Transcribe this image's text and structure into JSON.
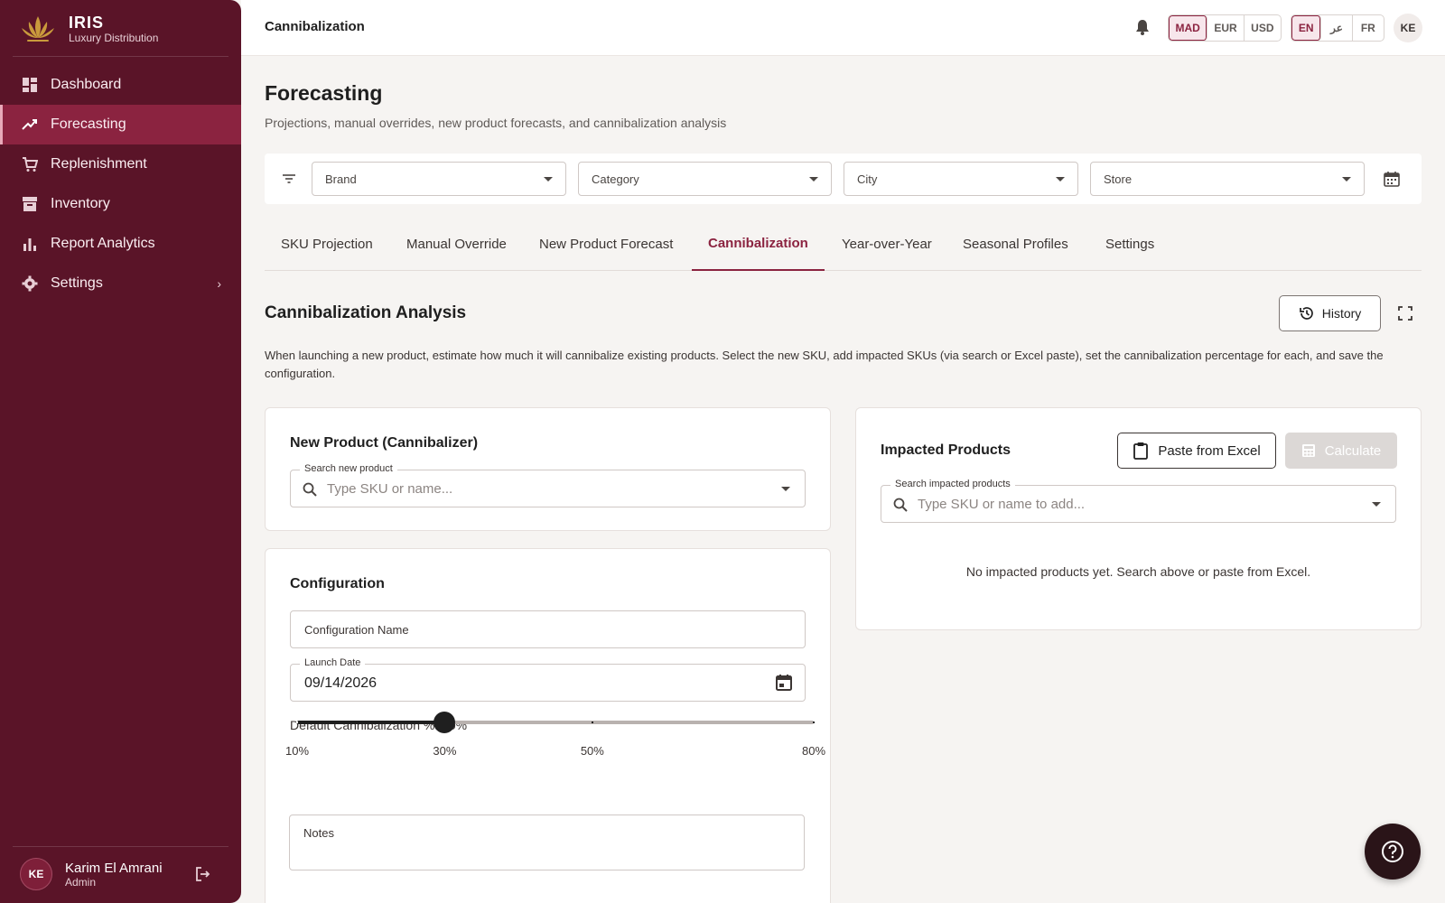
{
  "app": {
    "name": "IRIS",
    "subtitle": "Luxury Distribution"
  },
  "sidebar": {
    "items": [
      {
        "label": "Dashboard",
        "icon": "dashboard-icon"
      },
      {
        "label": "Forecasting",
        "icon": "trending-up-icon",
        "active": true
      },
      {
        "label": "Replenishment",
        "icon": "cart-icon"
      },
      {
        "label": "Inventory",
        "icon": "archive-icon"
      },
      {
        "label": "Report Analytics",
        "icon": "bar-chart-icon"
      },
      {
        "label": "Settings",
        "icon": "gear-icon",
        "has_submenu": true
      }
    ],
    "user": {
      "initials": "KE",
      "name": "Karim El Amrani",
      "role": "Admin"
    }
  },
  "topbar": {
    "title": "Cannibalization",
    "currencies": [
      "MAD",
      "EUR",
      "USD"
    ],
    "selected_currency": "MAD",
    "languages": [
      "EN",
      "عر",
      "FR"
    ],
    "selected_language": "EN",
    "avatar": "KE"
  },
  "page": {
    "title": "Forecasting",
    "subtitle": "Projections, manual overrides, new product forecasts, and cannibalization analysis"
  },
  "filters": {
    "brand": "Brand",
    "category": "Category",
    "city": "City",
    "store": "Store"
  },
  "tabs": [
    "SKU Projection",
    "Manual Override",
    "New Product Forecast",
    "Cannibalization",
    "Year-over-Year",
    "Seasonal Profiles",
    "Settings"
  ],
  "active_tab": "Cannibalization",
  "section": {
    "title": "Cannibalization Analysis",
    "history_label": "History",
    "description": "When launching a new product, estimate how much it will cannibalize existing products. Select the new SKU, add impacted SKUs (via search or Excel paste), set the cannibalization percentage for each, and save the configuration."
  },
  "new_product": {
    "title": "New Product (Cannibalizer)",
    "search_label": "Search new product",
    "search_placeholder": "Type SKU or name..."
  },
  "configuration": {
    "title": "Configuration",
    "name_placeholder": "Configuration Name",
    "launch_date_label": "Launch Date",
    "launch_date": "09/14/2026",
    "default_pct_label": "Default Cannibalization %: 30%",
    "slider": {
      "min": 10,
      "max": 80,
      "value": 30,
      "marks": [
        "10%",
        "30%",
        "50%",
        "80%"
      ]
    },
    "notes_placeholder": "Notes"
  },
  "impacted": {
    "title": "Impacted Products",
    "paste_label": "Paste from Excel",
    "calculate_label": "Calculate",
    "search_label": "Search impacted products",
    "search_placeholder": "Type SKU or name to add...",
    "empty_message": "No impacted products yet. Search above or paste from Excel."
  },
  "colors": {
    "primary": "#5a1428",
    "accent": "#8b2340",
    "active_nav": "#8b2340"
  }
}
